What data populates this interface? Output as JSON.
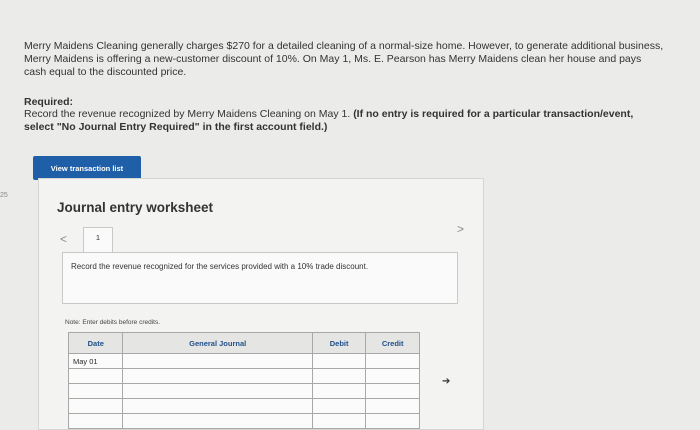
{
  "problem": {
    "text": "Merry Maidens Cleaning generally charges $270 for a detailed cleaning of a normal-size home. However, to generate additional business, Merry Maidens is offering a new-customer discount of 10%. On May 1, Ms. E. Pearson has Merry Maidens clean her house and pays cash equal to the discounted price."
  },
  "required": {
    "title": "Required:",
    "text_plain": "Record the revenue recognized by Merry Maidens Cleaning on May 1.",
    "text_bold": "(If no entry is required for a particular transaction/event, select \"No Journal Entry Required\" in the first account field.)"
  },
  "buttons": {
    "view_transaction": "View transaction list"
  },
  "side_marker": "25",
  "worksheet": {
    "title": "Journal entry worksheet",
    "prev": "<",
    "next": ">",
    "active_tab": "1",
    "description": "Record the revenue recognized for the services provided with a 10% trade discount.",
    "note": "Note: Enter debits before credits."
  },
  "journal": {
    "headers": [
      "Date",
      "General Journal",
      "Debit",
      "Credit"
    ],
    "rows": [
      {
        "date": "May 01",
        "account": "",
        "debit": "",
        "credit": ""
      },
      {
        "date": "",
        "account": "",
        "debit": "",
        "credit": ""
      },
      {
        "date": "",
        "account": "",
        "debit": "",
        "credit": ""
      },
      {
        "date": "",
        "account": "",
        "debit": "",
        "credit": ""
      },
      {
        "date": "",
        "account": "",
        "debit": "",
        "credit": ""
      }
    ]
  }
}
